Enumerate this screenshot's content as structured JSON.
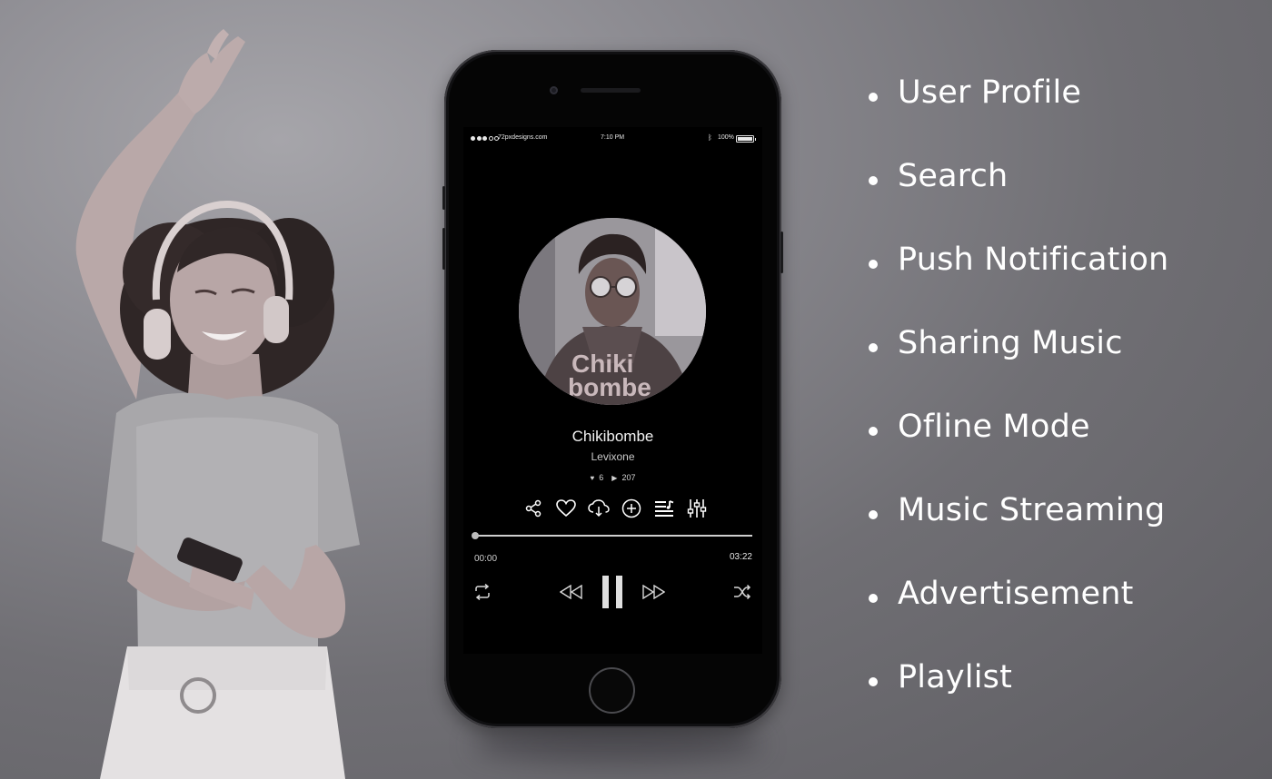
{
  "features": [
    "User Profile",
    "Search",
    "Push Notification",
    "Sharing Music",
    "Ofline Mode",
    "Music Streaming",
    "Advertisement",
    "Playlist"
  ],
  "status_bar": {
    "carrier": "72pxdesigns.com",
    "time": "7:10 PM",
    "battery": "100%",
    "signal_bars_filled": 3,
    "signal_bars_total": 5
  },
  "track": {
    "title": "Chikibombe",
    "artist": "Levixone",
    "artwork_text_line1": "Chiki",
    "artwork_text_line2": "bombe",
    "likes": "6",
    "plays": "207",
    "elapsed": "00:00",
    "duration": "03:22",
    "progress": 0.0
  },
  "icons": {
    "actions": [
      "share-icon",
      "heart-icon",
      "cloud-download-icon",
      "add-circle-icon",
      "playlist-icon",
      "equalizer-icon"
    ],
    "playback": [
      "repeat-icon",
      "rewind-icon",
      "pause-icon",
      "fast-forward-icon",
      "shuffle-icon"
    ]
  }
}
